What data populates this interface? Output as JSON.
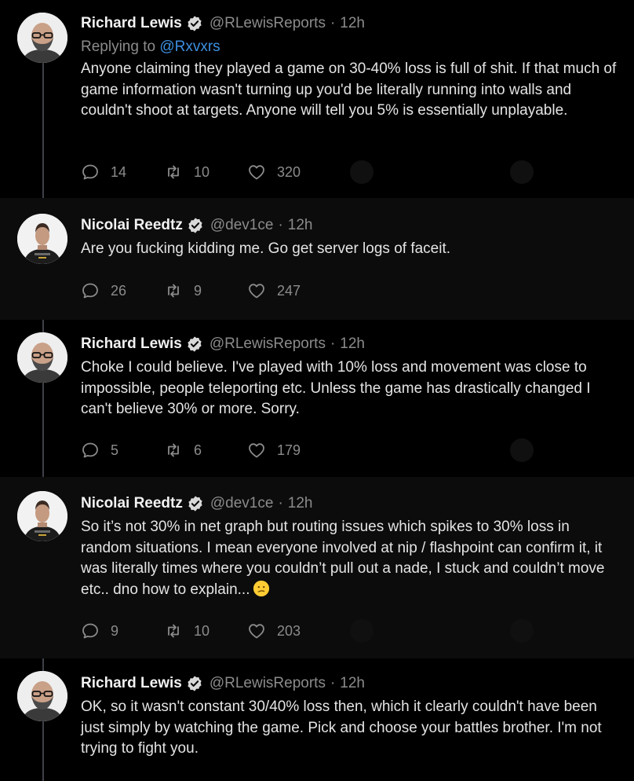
{
  "tweets": [
    {
      "author": "Richard Lewis",
      "handle": "@RLewisReports",
      "separator": "·",
      "time": "12h",
      "reply_prefix": "Replying to",
      "reply_to": "@Rxvxrs",
      "text": "Anyone claiming they played a game on 30-40% loss is full of shit. If that much of game information wasn't turning up you'd be literally running into walls and couldn't shoot at targets. Anyone will tell you 5% is essentially unplayable.",
      "replies": "14",
      "retweets": "10",
      "likes": "320"
    },
    {
      "author": "Nicolai Reedtz",
      "handle": "@dev1ce",
      "separator": "·",
      "time": "12h",
      "text": "Are you fucking kidding me. Go get server logs of faceit.",
      "replies": "26",
      "retweets": "9",
      "likes": "247"
    },
    {
      "author": "Richard Lewis",
      "handle": "@RLewisReports",
      "separator": "·",
      "time": "12h",
      "text": "Choke I could believe. I've played with 10% loss and movement was close to impossible, people teleporting etc. Unless the game has drastically changed I can't believe 30% or more. Sorry.",
      "replies": "5",
      "retweets": "6",
      "likes": "179"
    },
    {
      "author": "Nicolai Reedtz",
      "handle": "@dev1ce",
      "separator": "·",
      "time": "12h",
      "text": "So it’s not 30% in net graph but routing issues which spikes to 30% loss in random situations. I mean everyone involved at nip / flashpoint can confirm it, it was literally times where you couldn’t pull out a nade, I stuck and couldn’t move etc.. dno how to explain...",
      "emoji": "confused-face-icon",
      "replies": "9",
      "retweets": "10",
      "likes": "203"
    },
    {
      "author": "Richard Lewis",
      "handle": "@RLewisReports",
      "separator": "·",
      "time": "12h",
      "text": "OK, so it wasn't constant 30/40% loss then, which it clearly couldn't have been just simply by watching the game. Pick and choose your battles brother. I'm not trying to fight you."
    }
  ],
  "colors": {
    "background": "#000000",
    "alt_background": "#0c0c0c",
    "text": "#e4e4e4",
    "muted": "#8b8b8b",
    "link": "#3d8fe0",
    "thread_line": "#3d4148"
  }
}
